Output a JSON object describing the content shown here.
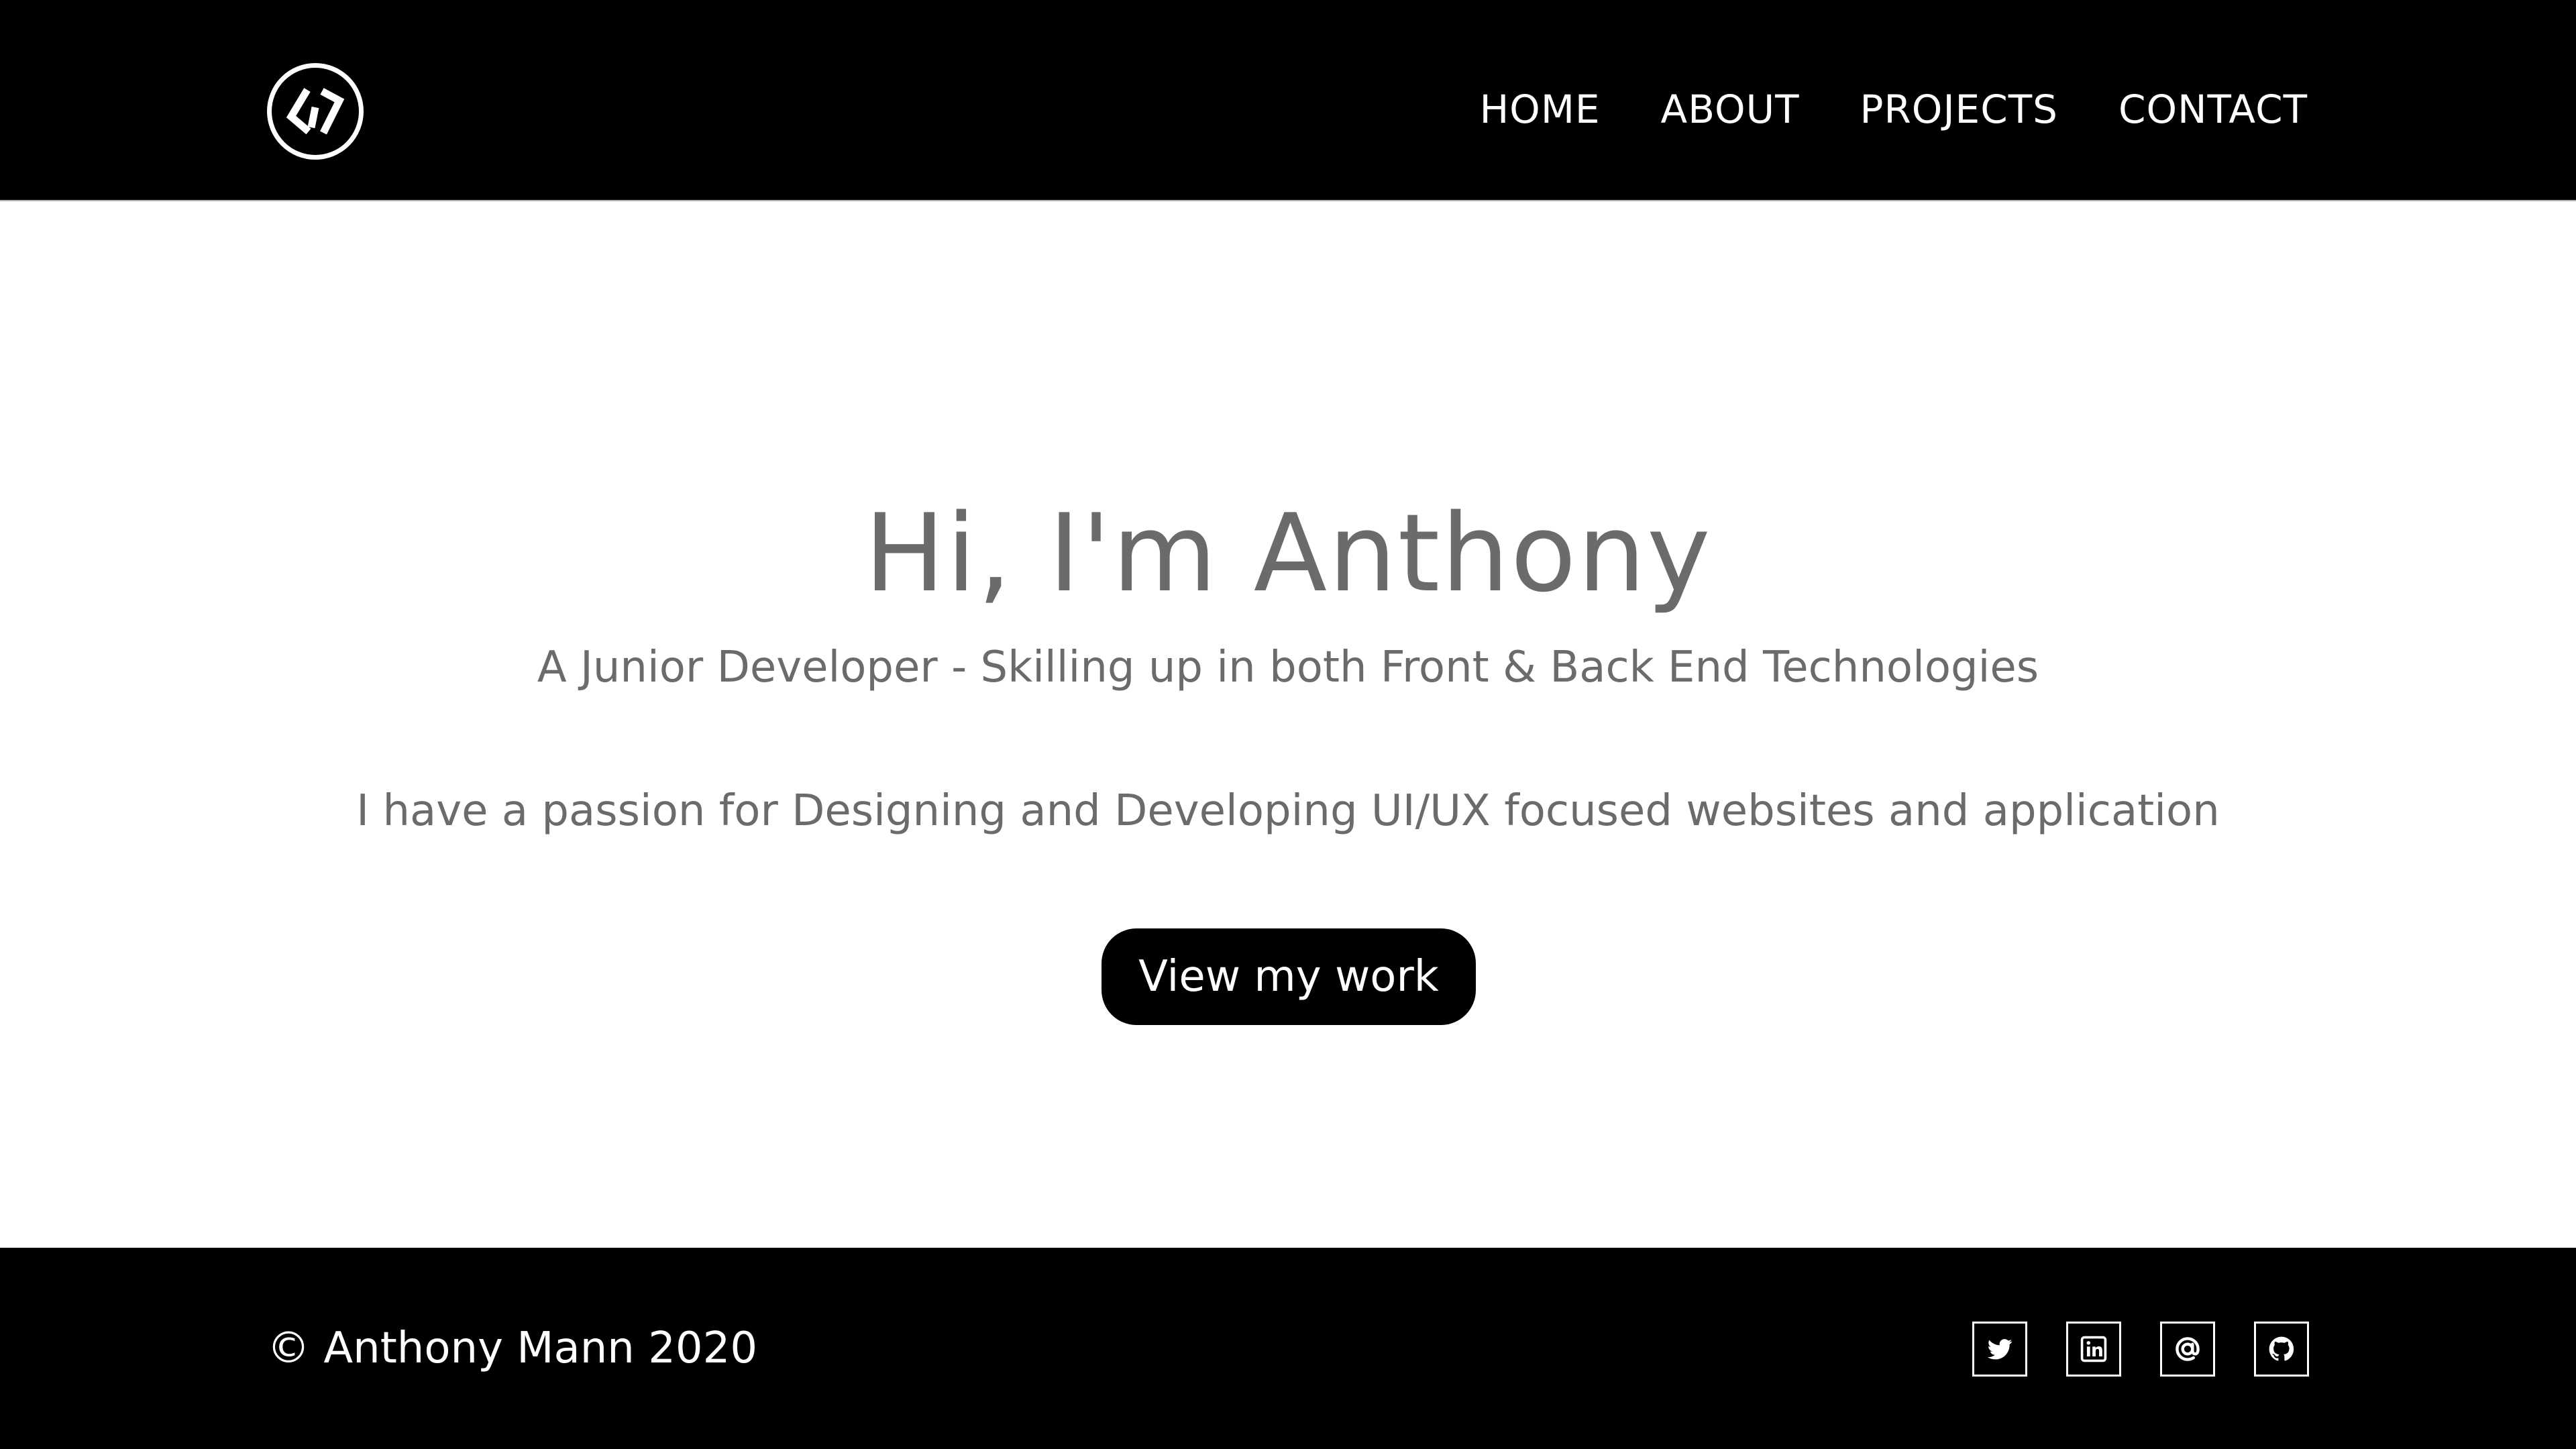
{
  "header": {
    "logo_icon": "code-brackets-logo-icon",
    "nav": [
      {
        "label": "HOME"
      },
      {
        "label": "ABOUT"
      },
      {
        "label": "PROJECTS"
      },
      {
        "label": "CONTACT"
      }
    ]
  },
  "hero": {
    "title": "Hi, I'm Anthony",
    "subtitle": "A Junior Developer - Skilling up in both Front & Back End Technologies",
    "tagline": "I have a passion for Designing and Developing UI/UX focused websites and application",
    "cta_label": "View my work"
  },
  "footer": {
    "copyright": "© Anthony Mann 2020",
    "socials": [
      {
        "icon": "twitter-icon"
      },
      {
        "icon": "linkedin-icon"
      },
      {
        "icon": "email-at-icon"
      },
      {
        "icon": "github-icon"
      }
    ]
  },
  "colors": {
    "header_bg": "#000000",
    "footer_bg": "#000000",
    "text_gray": "#6b6b6b",
    "button_bg": "#000000",
    "on_dark": "#ffffff"
  }
}
